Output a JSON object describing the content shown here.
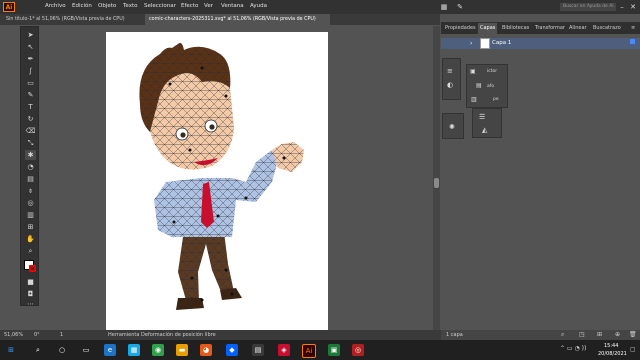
{
  "app": {
    "logo": "Ai"
  },
  "menu": [
    "Archivo",
    "Edición",
    "Objeto",
    "Texto",
    "Seleccionar",
    "Efecto",
    "Ver",
    "Ventana",
    "Ayuda"
  ],
  "search": {
    "placeholder": "Buscar en Ayuda de Ai"
  },
  "tabs": [
    {
      "label": "Sin título-1* al 51,06% (RGB/Vista previa de CPU)"
    },
    {
      "label": "comic-characters-2025311.svg* al 51,06% (RGB/Vista previa de CPU)"
    }
  ],
  "panels": {
    "tabs": [
      "Propiedades",
      "Capas",
      "Bibliotecas",
      "Transformar",
      "Alinear",
      "Buscatrazo"
    ],
    "layers": [
      {
        "name": "Capa 1"
      }
    ],
    "footer": "1 capa",
    "mini_labels": [
      "ictor",
      "afo",
      "pe"
    ]
  },
  "status": {
    "zoom": "51,06%",
    "rotation": "0°",
    "artboard": "1",
    "tool": "Herramienta Deformación de posición libre"
  },
  "taskbar": {
    "time": "15:44",
    "date": "20/08/2021"
  },
  "colors": {
    "accent": "#ff7c00",
    "panel_bg": "#535353",
    "dark": "#323232"
  }
}
